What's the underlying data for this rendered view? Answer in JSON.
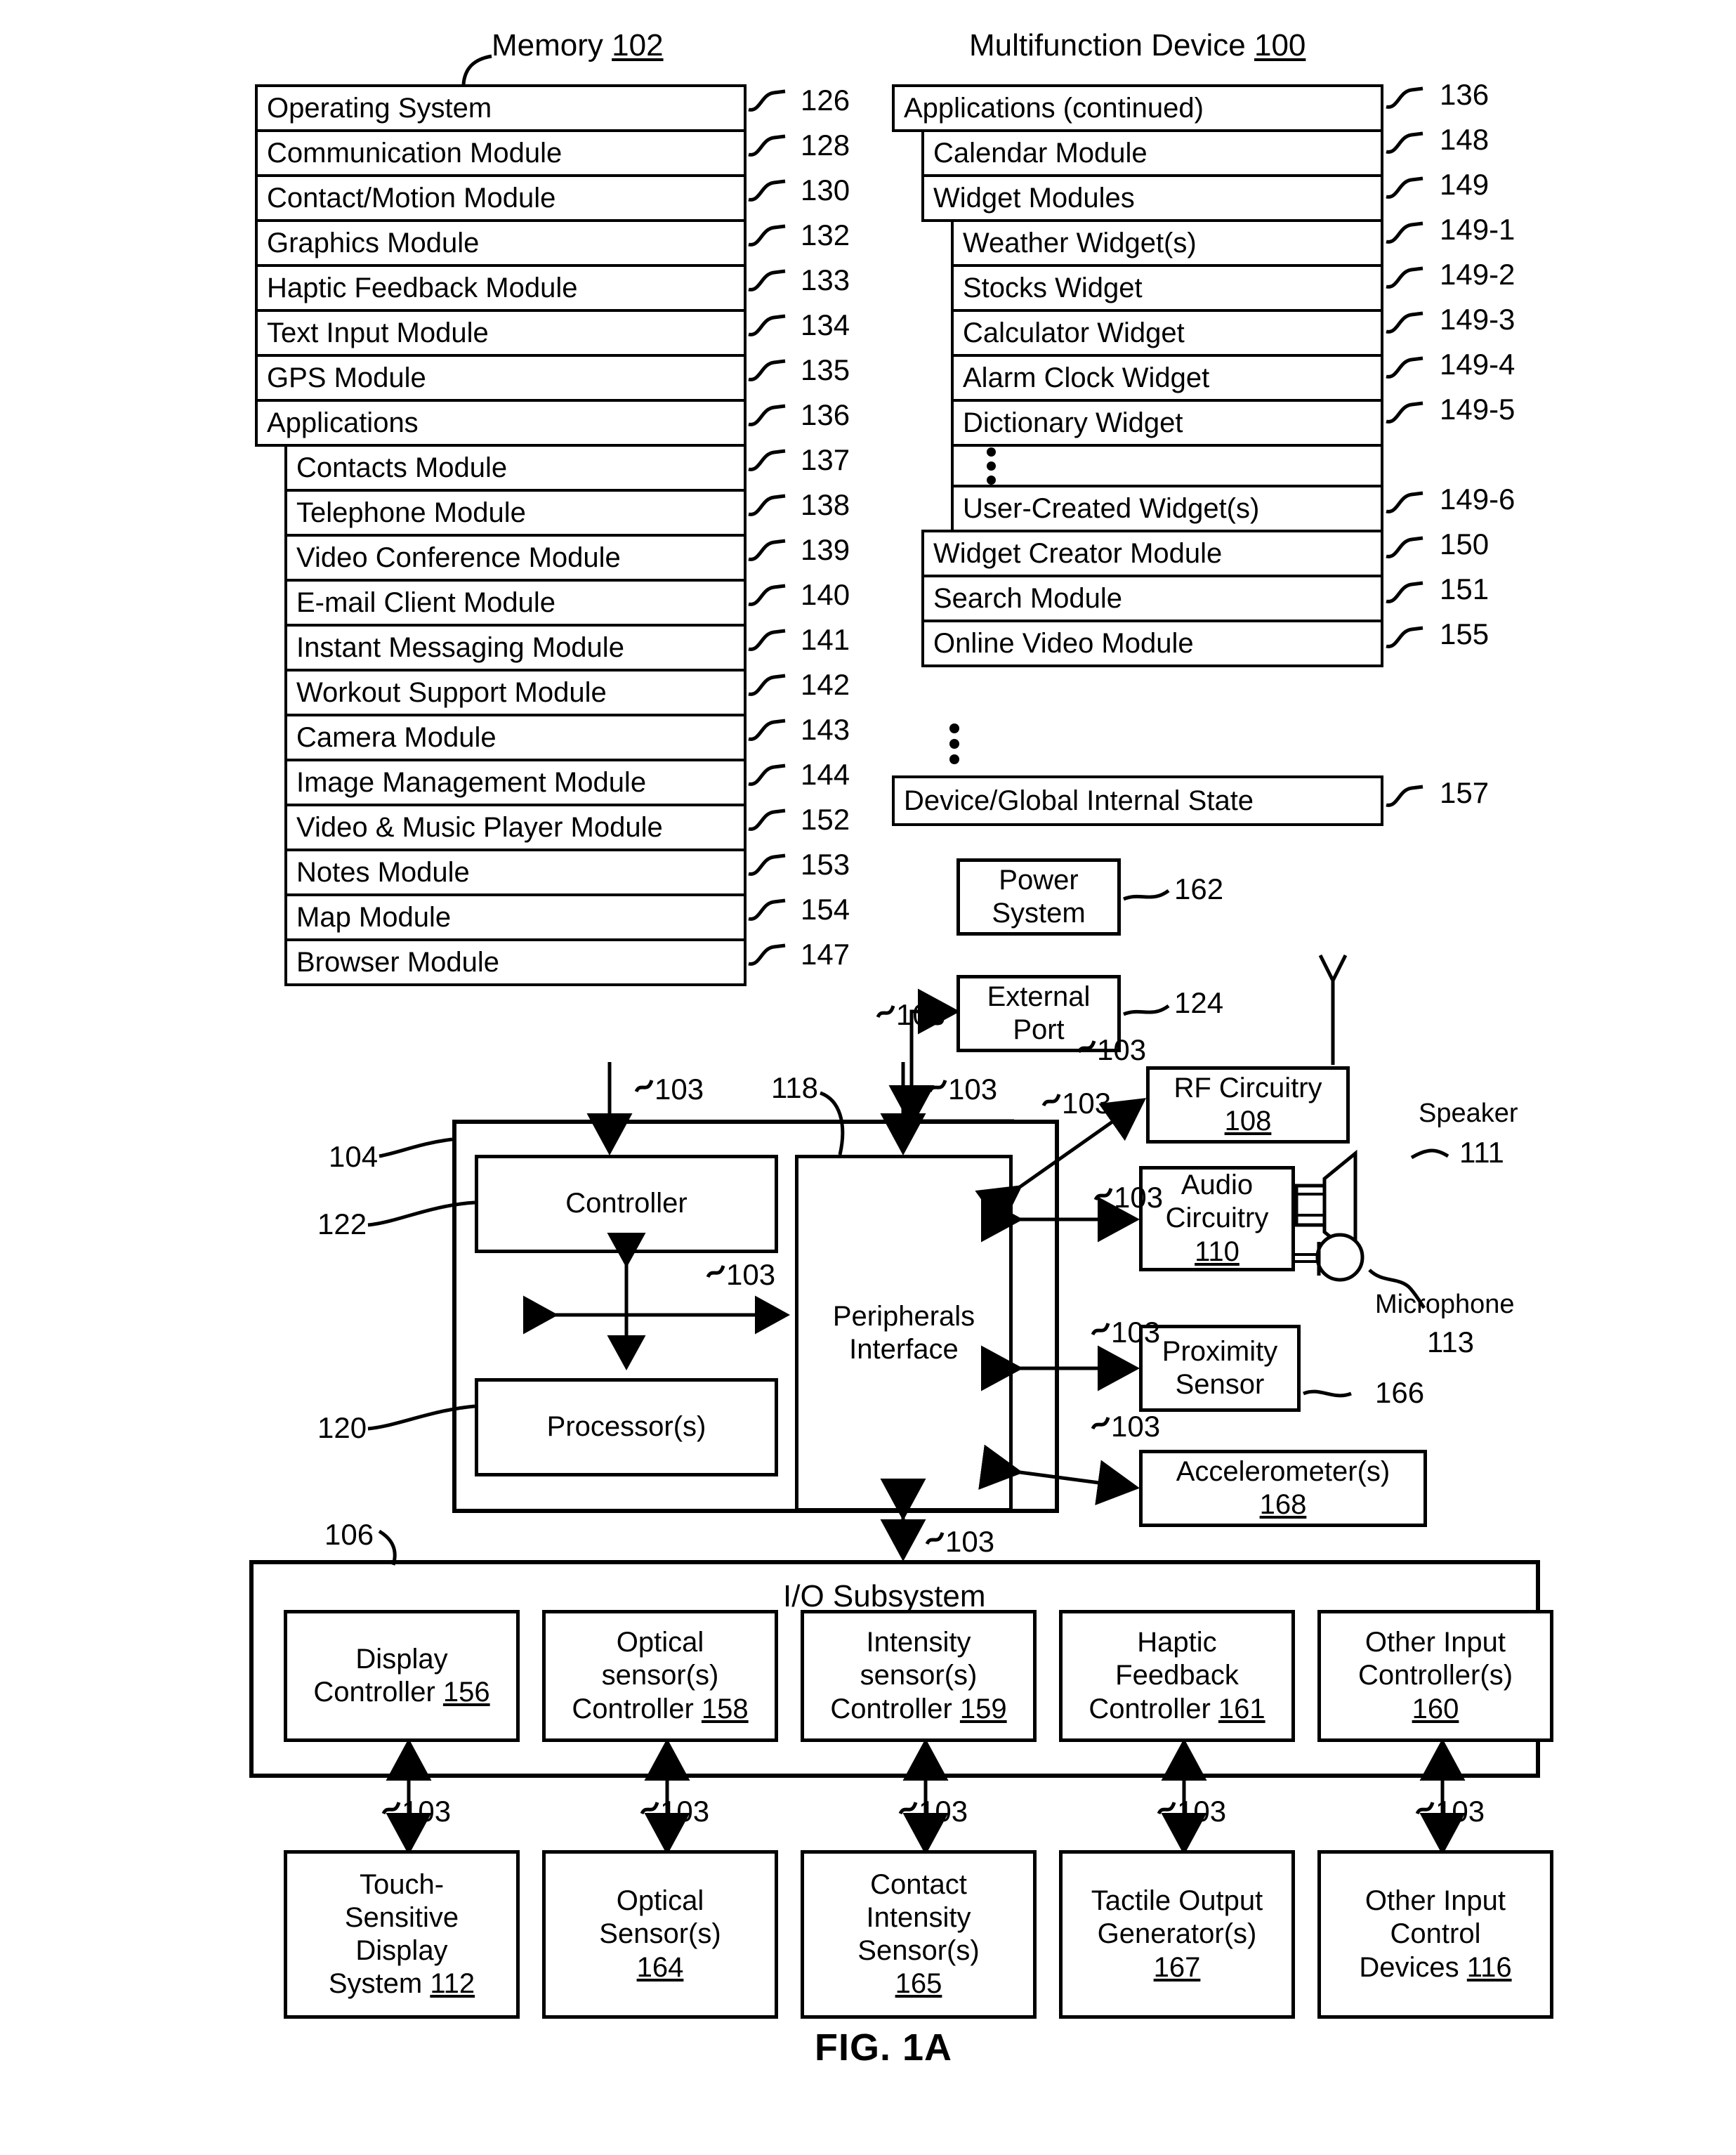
{
  "figure": {
    "label": "FIG. 1A",
    "memory_caption": "Memory",
    "memory_ref": "102",
    "device_caption": "Multifunction Device",
    "device_ref": "100"
  },
  "memory_stack": [
    {
      "label": "Operating System",
      "ref": "126",
      "indent": 0
    },
    {
      "label": "Communication Module",
      "ref": "128",
      "indent": 0
    },
    {
      "label": "Contact/Motion Module",
      "ref": "130",
      "indent": 0
    },
    {
      "label": "Graphics Module",
      "ref": "132",
      "indent": 0
    },
    {
      "label": "Haptic Feedback Module",
      "ref": "133",
      "indent": 0
    },
    {
      "label": "Text Input Module",
      "ref": "134",
      "indent": 0
    },
    {
      "label": "GPS Module",
      "ref": "135",
      "indent": 0
    },
    {
      "label": "Applications",
      "ref": "136",
      "indent": 0
    },
    {
      "label": "Contacts Module",
      "ref": "137",
      "indent": 1
    },
    {
      "label": "Telephone Module",
      "ref": "138",
      "indent": 1
    },
    {
      "label": "Video Conference Module",
      "ref": "139",
      "indent": 1
    },
    {
      "label": "E-mail Client Module",
      "ref": "140",
      "indent": 1
    },
    {
      "label": "Instant Messaging Module",
      "ref": "141",
      "indent": 1
    },
    {
      "label": "Workout Support Module",
      "ref": "142",
      "indent": 1
    },
    {
      "label": "Camera Module",
      "ref": "143",
      "indent": 1
    },
    {
      "label": "Image Management Module",
      "ref": "144",
      "indent": 1
    },
    {
      "label": "Video & Music Player Module",
      "ref": "152",
      "indent": 1
    },
    {
      "label": "Notes Module",
      "ref": "153",
      "indent": 1
    },
    {
      "label": "Map Module",
      "ref": "154",
      "indent": 1
    },
    {
      "label": "Browser Module",
      "ref": "147",
      "indent": 1
    }
  ],
  "device_stack": [
    {
      "label": "Applications (continued)",
      "ref": "136",
      "indent": 0,
      "dots": false
    },
    {
      "label": "Calendar Module",
      "ref": "148",
      "indent": 1,
      "dots": false
    },
    {
      "label": "Widget Modules",
      "ref": "149",
      "indent": 1,
      "dots": false
    },
    {
      "label": "Weather Widget(s)",
      "ref": "149-1",
      "indent": 2,
      "dots": false
    },
    {
      "label": "Stocks Widget",
      "ref": "149-2",
      "indent": 2,
      "dots": false
    },
    {
      "label": "Calculator Widget",
      "ref": "149-3",
      "indent": 2,
      "dots": false
    },
    {
      "label": "Alarm Clock Widget",
      "ref": "149-4",
      "indent": 2,
      "dots": false
    },
    {
      "label": "Dictionary Widget",
      "ref": "149-5",
      "indent": 2,
      "dots": false
    },
    {
      "label": "",
      "ref": "",
      "indent": 2,
      "dots": true
    },
    {
      "label": "User-Created Widget(s)",
      "ref": "149-6",
      "indent": 2,
      "dots": false
    },
    {
      "label": "Widget Creator Module",
      "ref": "150",
      "indent": 1,
      "dots": false
    },
    {
      "label": "Search Module",
      "ref": "151",
      "indent": 1,
      "dots": false
    },
    {
      "label": "Online Video Module",
      "ref": "155",
      "indent": 1,
      "dots": false
    }
  ],
  "device_state": {
    "label": "Device/Global Internal State",
    "ref": "157"
  },
  "components": {
    "power_system": {
      "line1": "Power",
      "line2": "System",
      "ref": "162"
    },
    "external_port": {
      "line1": "External",
      "line2": "Port",
      "ref": "124"
    },
    "rf_circuitry": {
      "line1": "RF Circuitry",
      "num": "108"
    },
    "audio_circuitry": {
      "line1": "Audio",
      "line2": "Circuitry",
      "num": "110"
    },
    "speaker": {
      "label": "Speaker",
      "ref": "111"
    },
    "microphone": {
      "label": "Microphone",
      "ref": "113"
    },
    "proximity": {
      "line1": "Proximity",
      "line2": "Sensor",
      "ref": "166"
    },
    "accelerometer": {
      "line1": "Accelerometer(s)",
      "num": "168"
    },
    "controller": {
      "label": "Controller",
      "ref": "122"
    },
    "processors": {
      "label": "Processor(s)",
      "ref": "120"
    },
    "peripherals": {
      "line1": "Peripherals",
      "line2": "Interface",
      "ref": "118"
    },
    "cpu_group_ref": "104",
    "io_subsystem": {
      "label": "I/O Subsystem",
      "ref": "106"
    },
    "bus_ref": "103"
  },
  "io_controllers": [
    {
      "line1": "Display",
      "line2": "",
      "line3": "Controller",
      "num": "156"
    },
    {
      "line1": "Optical",
      "line2": "sensor(s)",
      "line3": "Controller",
      "num": "158"
    },
    {
      "line1": "Intensity",
      "line2": "sensor(s)",
      "line3": "Controller",
      "num": "159"
    },
    {
      "line1": "Haptic",
      "line2": "Feedback",
      "line3": "Controller",
      "num": "161"
    },
    {
      "line1": "Other Input",
      "line2": "Controller(s)",
      "line3": "",
      "num": "160"
    }
  ],
  "io_devices": [
    {
      "line1": "Touch-",
      "line2": "Sensitive",
      "line3": "Display",
      "line4": "System",
      "num": "112"
    },
    {
      "line1": "Optical",
      "line2": "Sensor(s)",
      "line3": "",
      "line4": "",
      "num": "164"
    },
    {
      "line1": "Contact",
      "line2": "Intensity",
      "line3": "Sensor(s)",
      "line4": "",
      "num": "165"
    },
    {
      "line1": "Tactile Output",
      "line2": "Generator(s)",
      "line3": "",
      "line4": "",
      "num": "167"
    },
    {
      "line1": "Other Input",
      "line2": "Control",
      "line3": "Devices",
      "line4": "",
      "num": "116"
    }
  ],
  "bus_labels": [
    "103",
    "103",
    "103",
    "103",
    "103",
    "103",
    "103",
    "103",
    "103",
    "103",
    "103",
    "103",
    "103",
    "103",
    "103",
    "103"
  ],
  "colors": {
    "ink": "#000000",
    "paper": "#ffffff"
  }
}
